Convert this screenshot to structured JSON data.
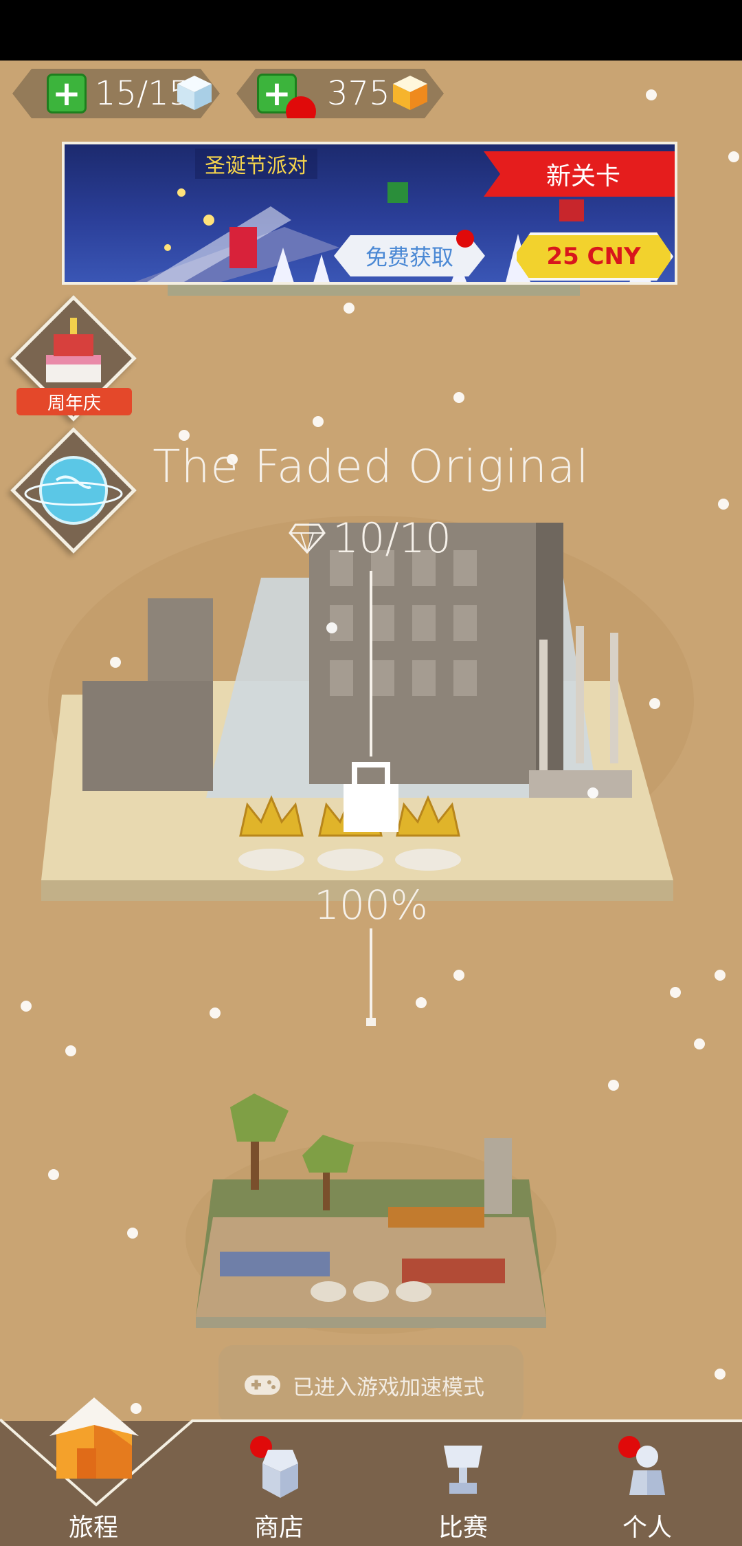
{
  "resources": {
    "energy": "15/15",
    "gems": "375"
  },
  "banner": {
    "title": "圣诞节派对",
    "tag": "新关卡",
    "free_button": "免费获取",
    "price_button": "25 CNY"
  },
  "side": {
    "anniversary_label": "周年庆"
  },
  "level": {
    "title": "The Faded Original",
    "gems_collected": "10/10",
    "progress_text": "100%"
  },
  "toast": {
    "text": "已进入游戏加速模式"
  },
  "nav": {
    "items": [
      {
        "label": "旅程",
        "icon": "house-icon"
      },
      {
        "label": "商店",
        "icon": "shop-icon"
      },
      {
        "label": "比赛",
        "icon": "trophy-icon"
      },
      {
        "label": "个人",
        "icon": "profile-icon"
      }
    ]
  },
  "colors": {
    "background": "#c9a473",
    "nav_bar": "#7a624b",
    "accent_red": "#e51d1d",
    "plus_green": "#3cb43c"
  }
}
